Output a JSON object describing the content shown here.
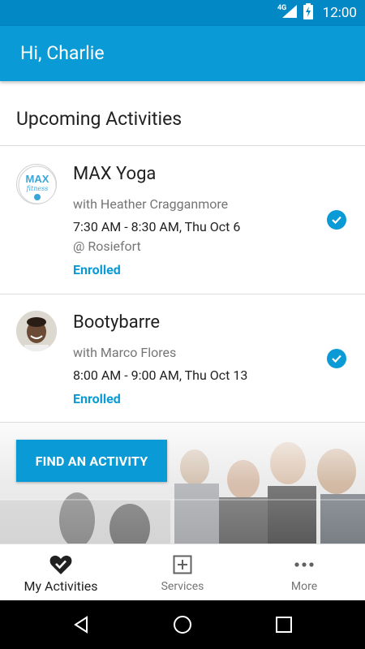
{
  "status_bar": {
    "network": "4G",
    "time": "12:00"
  },
  "header": {
    "greeting": "Hi, Charlie"
  },
  "section": {
    "title": "Upcoming Activities"
  },
  "activities": [
    {
      "title": "MAX Yoga",
      "instructor": "with Heather Cragganmore",
      "time": "7:30 AM - 8:30 AM, Thu Oct 6",
      "location": "@ Rosiefort",
      "status": "Enrolled",
      "avatar_text_top": "MAX",
      "avatar_text_bottom": "fitness"
    },
    {
      "title": "Bootybarre",
      "instructor": "with Marco Flores",
      "time": "8:00 AM - 9:00 AM, Thu Oct 13",
      "status": "Enrolled"
    }
  ],
  "banner": {
    "button_label": "FIND AN ACTIVITY"
  },
  "bottom_nav": {
    "items": [
      {
        "label": "My Activities",
        "icon": "heart-check-icon",
        "active": true
      },
      {
        "label": "Services",
        "icon": "plus-square-icon",
        "active": false
      },
      {
        "label": "More",
        "icon": "more-dots-icon",
        "active": false
      }
    ]
  },
  "colors": {
    "primary": "#0a9bd6",
    "status_bar": "#0288c5"
  }
}
